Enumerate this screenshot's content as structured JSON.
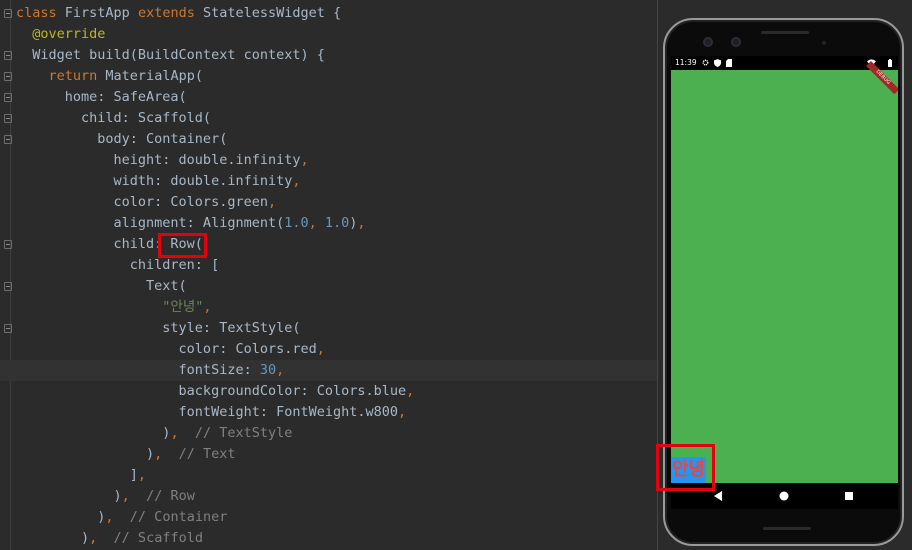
{
  "editor": {
    "lines": [
      [
        {
          "t": "class ",
          "c": "kw"
        },
        {
          "t": "FirstApp ",
          "c": ""
        },
        {
          "t": "extends ",
          "c": "kw"
        },
        {
          "t": "StatelessWidget {",
          "c": ""
        }
      ],
      [
        {
          "t": "  @override",
          "c": "ann"
        }
      ],
      [
        {
          "t": "  Widget build(BuildContext context) {",
          "c": ""
        }
      ],
      [
        {
          "t": "    ",
          "c": ""
        },
        {
          "t": "return ",
          "c": "kw"
        },
        {
          "t": "MaterialApp(",
          "c": ""
        }
      ],
      [
        {
          "t": "      home: SafeArea(",
          "c": ""
        }
      ],
      [
        {
          "t": "        child: Scaffold(",
          "c": ""
        }
      ],
      [
        {
          "t": "          body: Container(",
          "c": ""
        }
      ],
      [
        {
          "t": "            height: double.infinity",
          "c": ""
        },
        {
          "t": ",",
          "c": "kw"
        }
      ],
      [
        {
          "t": "            width: double.infinity",
          "c": ""
        },
        {
          "t": ",",
          "c": "kw"
        }
      ],
      [
        {
          "t": "            color: Colors.green",
          "c": ""
        },
        {
          "t": ",",
          "c": "kw"
        }
      ],
      [
        {
          "t": "            alignment: Alignment(",
          "c": ""
        },
        {
          "t": "1.0",
          "c": "num"
        },
        {
          "t": ", ",
          "c": "kw"
        },
        {
          "t": "1.0",
          "c": "num"
        },
        {
          "t": ")",
          "c": ""
        },
        {
          "t": ",",
          "c": "kw"
        }
      ],
      [
        {
          "t": "            child: Row(",
          "c": ""
        }
      ],
      [
        {
          "t": "              children: [",
          "c": ""
        }
      ],
      [
        {
          "t": "                Text(",
          "c": ""
        }
      ],
      [
        {
          "t": "                  \"안녕\"",
          "c": "str"
        },
        {
          "t": ",",
          "c": "kw"
        }
      ],
      [
        {
          "t": "                  style: TextStyle(",
          "c": ""
        }
      ],
      [
        {
          "t": "                    color: Colors.red",
          "c": ""
        },
        {
          "t": ",",
          "c": "kw"
        }
      ],
      [
        {
          "t": "                    fontSize: ",
          "c": ""
        },
        {
          "t": "30",
          "c": "num"
        },
        {
          "t": ",",
          "c": "kw"
        }
      ],
      [
        {
          "t": "                    backgroundColor: Colors.blue",
          "c": ""
        },
        {
          "t": ",",
          "c": "kw"
        }
      ],
      [
        {
          "t": "                    fontWeight: FontWeight.w800",
          "c": ""
        },
        {
          "t": ",",
          "c": "kw"
        }
      ],
      [
        {
          "t": "                  )",
          "c": ""
        },
        {
          "t": ",",
          "c": "kw"
        },
        {
          "t": "  // TextStyle",
          "c": "com"
        }
      ],
      [
        {
          "t": "                )",
          "c": ""
        },
        {
          "t": ",",
          "c": "kw"
        },
        {
          "t": "  // Text",
          "c": "com"
        }
      ],
      [
        {
          "t": "              ]",
          "c": ""
        },
        {
          "t": ",",
          "c": "kw"
        }
      ],
      [
        {
          "t": "            )",
          "c": ""
        },
        {
          "t": ",",
          "c": "kw"
        },
        {
          "t": "  // Row",
          "c": "com"
        }
      ],
      [
        {
          "t": "          )",
          "c": ""
        },
        {
          "t": ",",
          "c": "kw"
        },
        {
          "t": "  // Container",
          "c": "com"
        }
      ],
      [
        {
          "t": "        )",
          "c": ""
        },
        {
          "t": ",",
          "c": "kw"
        },
        {
          "t": "  // Scaffold",
          "c": "com"
        }
      ]
    ],
    "current_line": 17
  },
  "phone": {
    "status_time": "11:39",
    "status_icons_left": [
      "settings-icon",
      "shield-icon",
      "sim-icon"
    ],
    "status_icons_right": [
      "wifi-icon",
      "battery-icon"
    ],
    "debug_banner": "DEBUG",
    "text_widget": "안녕",
    "body_color": "#4caf50",
    "text_color": "#f44336",
    "text_bg_color": "#2196f3",
    "nav_buttons": [
      "back-icon",
      "home-icon",
      "recents-icon"
    ]
  }
}
